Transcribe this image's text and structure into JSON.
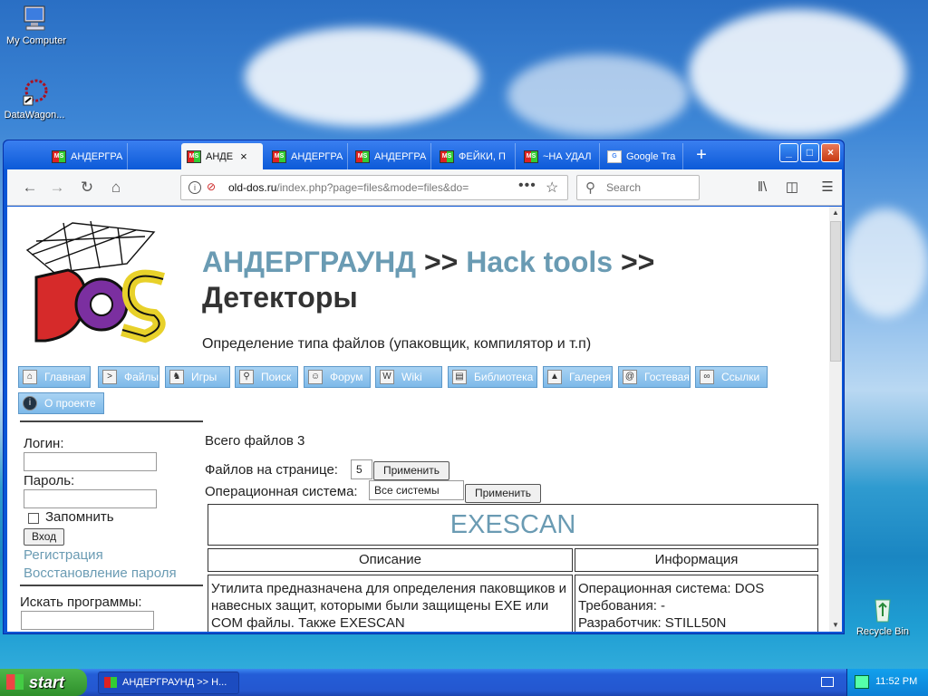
{
  "desktop": {
    "icons": [
      {
        "label": "My Computer"
      },
      {
        "label": "DataWagon..."
      },
      {
        "label": "Recycle Bin"
      }
    ]
  },
  "browser": {
    "tabs": [
      {
        "label": "АНДЕРГРА"
      },
      {
        "label": "АНДЕ",
        "close": "×"
      },
      {
        "label": "АНДЕРГРА"
      },
      {
        "label": "АНДЕРГРА"
      },
      {
        "label": "ФЕЙКИ, П"
      },
      {
        "label": "~НА УДАЛ"
      },
      {
        "label": "Google Tra"
      }
    ],
    "new_tab": "+",
    "window_buttons": {
      "minimize": "_",
      "maximize": "□",
      "close": "×"
    },
    "url": {
      "host": "old-dos.ru",
      "path": "/index.php?page=files&mode=files&do="
    },
    "url_menu": "•••",
    "search_placeholder": "Search"
  },
  "page": {
    "breadcrumb": {
      "root": "АНДЕРГРАУНД",
      "sep1": ">>",
      "section": "Hack tools",
      "sep2": ">>",
      "current": "Детекторы"
    },
    "subtitle": "Определение типа файлов (упаковщик, компилятор и т.п)",
    "menu": [
      {
        "label": "Главная"
      },
      {
        "label": "Файлы"
      },
      {
        "label": "Игры"
      },
      {
        "label": "Поиск"
      },
      {
        "label": "Форум"
      },
      {
        "label": "Wiki"
      },
      {
        "label": "Библиотека"
      },
      {
        "label": "Галерея"
      },
      {
        "label": "Гостевая"
      },
      {
        "label": "Ссылки"
      },
      {
        "label": "О проекте"
      }
    ],
    "sidebar": {
      "login_label": "Логин:",
      "password_label": "Пароль:",
      "remember_label": "Запомнить",
      "login_button": "Вход",
      "register_link": "Регистрация",
      "restore_link": "Восстановление пароля",
      "search_label": "Искать программы:"
    },
    "main": {
      "total_files": "Всего файлов 3",
      "per_page_label": "Файлов на странице:",
      "per_page_value": "5",
      "apply_label": "Применить",
      "os_label": "Операционная система:",
      "os_value": "Все системы",
      "program": {
        "name": "EXESCAN",
        "desc_header": "Описание",
        "info_header": "Информация",
        "description": "Утилита предназначена для определения паковщиков и навесных защит, которыми были защищены EXE или COM файлы. Также EXESCAN",
        "info_lines": [
          "Операционная система: DOS",
          "Требования: -",
          "Разработчик: STILL50N"
        ]
      }
    }
  },
  "taskbar": {
    "start_label": "start",
    "task_label": "АНДЕРГРАУНД >> Н...",
    "clock": "11:52 PM"
  }
}
